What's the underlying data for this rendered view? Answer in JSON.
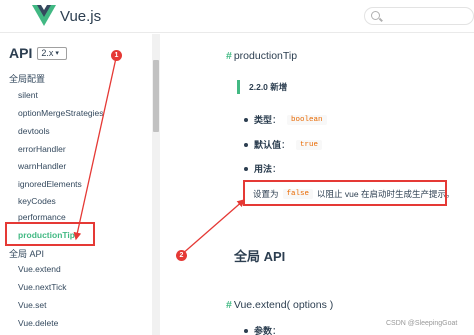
{
  "header": {
    "brand": "Vue.js"
  },
  "sidebar": {
    "api_title": "API",
    "version": "2.x",
    "global_config_label": "全局配置",
    "config_items": [
      "silent",
      "optionMergeStrategies",
      "devtools",
      "errorHandler",
      "warnHandler",
      "ignoredElements",
      "keyCodes",
      "performance",
      "productionTip"
    ],
    "global_api_label": "全局 API",
    "api_items": [
      "Vue.extend",
      "Vue.nextTick",
      "Vue.set",
      "Vue.delete"
    ]
  },
  "content": {
    "heading_hash": "#",
    "production_tip_heading": "productionTip",
    "tip_text": "2.2.0 新增",
    "type_label": "类型",
    "type_value": "boolean",
    "default_label": "默认值",
    "default_value": "true",
    "usage_label": "用法",
    "usage_before": "设置为",
    "usage_code": "false",
    "usage_after": "以阻止 vue 在启动时生成生产提示。",
    "global_api_heading": "全局 API",
    "vue_extend_heading": "Vue.extend( options )",
    "params_label": "参数"
  },
  "annotations": {
    "marker_1": "1",
    "marker_2": "2",
    "color": "#e53935"
  },
  "watermark": "CSDN @SleepingGoat",
  "colors": {
    "accent": "#42b983",
    "text": "#2c3e50",
    "code": "#e96900",
    "annotation": "#e53935"
  }
}
